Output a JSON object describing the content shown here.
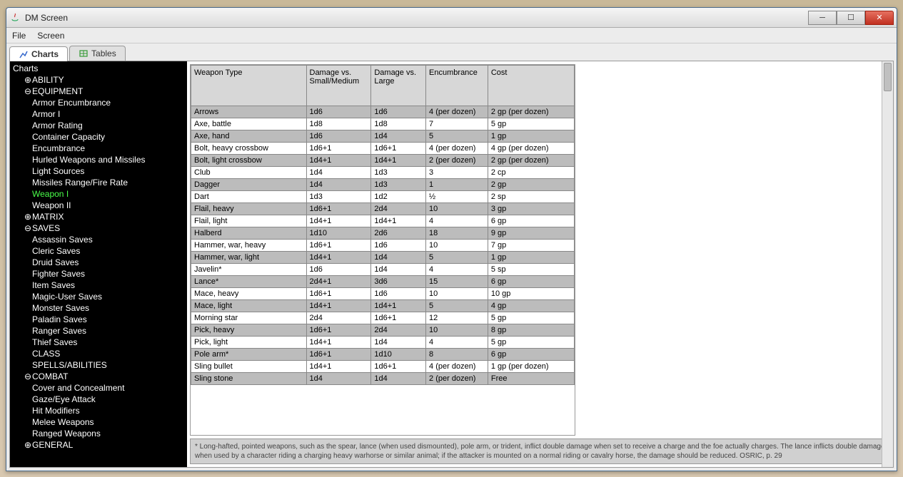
{
  "window": {
    "title": "DM Screen"
  },
  "menubar": {
    "file": "File",
    "screen": "Screen"
  },
  "tabs": {
    "charts": "Charts",
    "tables": "Tables"
  },
  "tree": {
    "root": "Charts",
    "ability": "ABILITY",
    "equipment": "EQUIPMENT",
    "equipment_items": [
      "Armor Encumbrance",
      "Armor I",
      "Armor Rating",
      "Container Capacity",
      "Encumbrance",
      "Hurled Weapons and Missiles",
      "Light Sources",
      "Missiles Range/Fire Rate",
      "Weapon I",
      "Weapon II"
    ],
    "matrix": "MATRIX",
    "saves": "SAVES",
    "saves_items": [
      "Assassin Saves",
      "Cleric Saves",
      "Druid Saves",
      "Fighter Saves",
      "Item Saves",
      "Magic-User Saves",
      "Monster Saves",
      "Paladin Saves",
      "Ranger Saves",
      "Thief Saves"
    ],
    "class": "CLASS",
    "spells": "SPELLS/ABILITIES",
    "combat": "COMBAT",
    "combat_items": [
      "Cover and Concealment",
      "Gaze/Eye Attack",
      "Hit Modifiers",
      "Melee Weapons",
      "Ranged Weapons"
    ],
    "general": "GENERAL"
  },
  "table": {
    "headers": [
      "Weapon Type",
      "Damage vs. Small/Medium",
      "Damage vs. Large",
      "Encumbrance",
      "Cost"
    ],
    "rows": [
      [
        "Arrows",
        "1d6",
        "1d6",
        "4 (per dozen)",
        "2 gp (per dozen)"
      ],
      [
        "Axe, battle",
        "1d8",
        "1d8",
        "7",
        "5 gp"
      ],
      [
        "Axe, hand",
        "1d6",
        "1d4",
        "5",
        "1 gp"
      ],
      [
        "Bolt, heavy crossbow",
        "1d6+1",
        "1d6+1",
        "4 (per dozen)",
        "4 gp (per dozen)"
      ],
      [
        "Bolt, light crossbow",
        "1d4+1",
        "1d4+1",
        "2 (per dozen)",
        "2 gp (per dozen)"
      ],
      [
        "Club",
        "1d4",
        "1d3",
        "3",
        "2 cp"
      ],
      [
        "Dagger",
        "1d4",
        "1d3",
        "1",
        "2 gp"
      ],
      [
        "Dart",
        "1d3",
        "1d2",
        "½",
        "2 sp"
      ],
      [
        "Flail, heavy",
        "1d6+1",
        "2d4",
        "10",
        "3 gp"
      ],
      [
        "Flail, light",
        "1d4+1",
        "1d4+1",
        "4",
        "6 gp"
      ],
      [
        "Halberd",
        "1d10",
        "2d6",
        "18",
        "9 gp"
      ],
      [
        "Hammer, war, heavy",
        "1d6+1",
        "1d6",
        "10",
        "7 gp"
      ],
      [
        "Hammer, war, light",
        "1d4+1",
        "1d4",
        "5",
        "1 gp"
      ],
      [
        "Javelin*",
        "1d6",
        "1d4",
        "4",
        "5 sp"
      ],
      [
        "Lance*",
        "2d4+1",
        "3d6",
        "15",
        "6 gp"
      ],
      [
        "Mace, heavy",
        "1d6+1",
        "1d6",
        "10",
        "10 gp"
      ],
      [
        "Mace, light",
        "1d4+1",
        "1d4+1",
        "5",
        "4 gp"
      ],
      [
        "Morning star",
        "2d4",
        "1d6+1",
        "12",
        "5 gp"
      ],
      [
        "Pick, heavy",
        "1d6+1",
        "2d4",
        "10",
        "8 gp"
      ],
      [
        "Pick, light",
        "1d4+1",
        "1d4",
        "4",
        "5 gp"
      ],
      [
        "Pole arm*",
        "1d6+1",
        "1d10",
        "8",
        "6 gp"
      ],
      [
        "Sling bullet",
        "1d4+1",
        "1d6+1",
        "4 (per dozen)",
        "1 gp (per dozen)"
      ],
      [
        "Sling stone",
        "1d4",
        "1d4",
        "2 (per dozen)",
        "Free"
      ]
    ]
  },
  "footnote": "* Long-hafted, pointed weapons, such as the spear, lance (when used dismounted), pole arm, or trident, inflict double damage when set to receive a charge and the foe actually charges. The lance inflicts double damage when used by a character riding a charging heavy warhorse or similar animal; if the attacker is mounted on a normal riding or cavalry horse, the damage should be reduced. OSRIC, p. 29"
}
